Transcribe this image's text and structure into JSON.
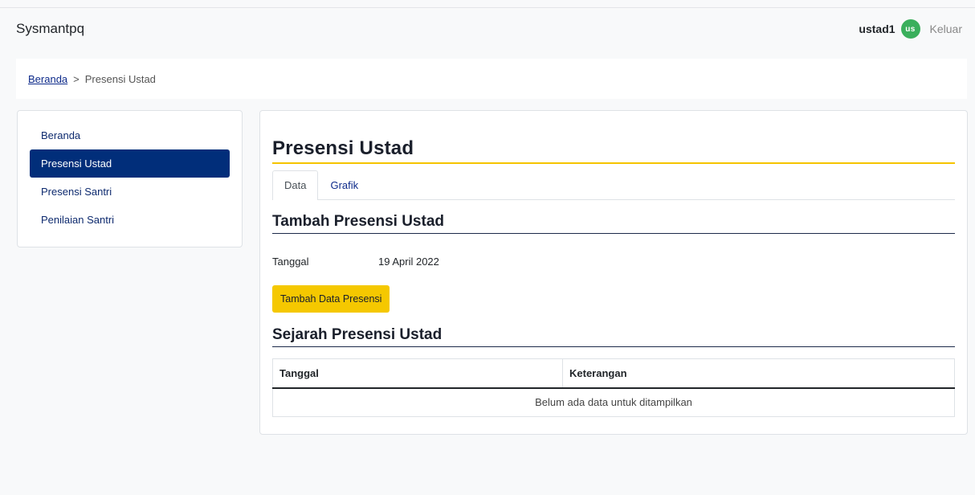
{
  "app": {
    "brand": "Sysmantpq"
  },
  "user": {
    "name": "ustad1",
    "initials": "us",
    "logout_label": "Keluar",
    "avatar_color": "#3aaf5c"
  },
  "breadcrumb": {
    "home": "Beranda",
    "separator": ">",
    "current": "Presensi Ustad"
  },
  "sidebar": {
    "items": [
      {
        "label": "Beranda",
        "active": false
      },
      {
        "label": "Presensi Ustad",
        "active": true
      },
      {
        "label": "Presensi Santri",
        "active": false
      },
      {
        "label": "Penilaian Santri",
        "active": false
      }
    ],
    "active_color": "#012e7a"
  },
  "main": {
    "title": "Presensi Ustad",
    "tabs": [
      {
        "label": "Data",
        "active": true
      },
      {
        "label": "Grafik",
        "active": false
      }
    ],
    "add_section": {
      "title": "Tambah Presensi Ustad",
      "date_label": "Tanggal",
      "date_value": "19 April 2022",
      "button_label": "Tambah Data Presensi",
      "button_color": "#f5c800"
    },
    "history_section": {
      "title": "Sejarah Presensi Ustad",
      "columns": [
        "Tanggal",
        "Keterangan"
      ],
      "empty_message": "Belum ada data untuk ditampilkan"
    }
  }
}
